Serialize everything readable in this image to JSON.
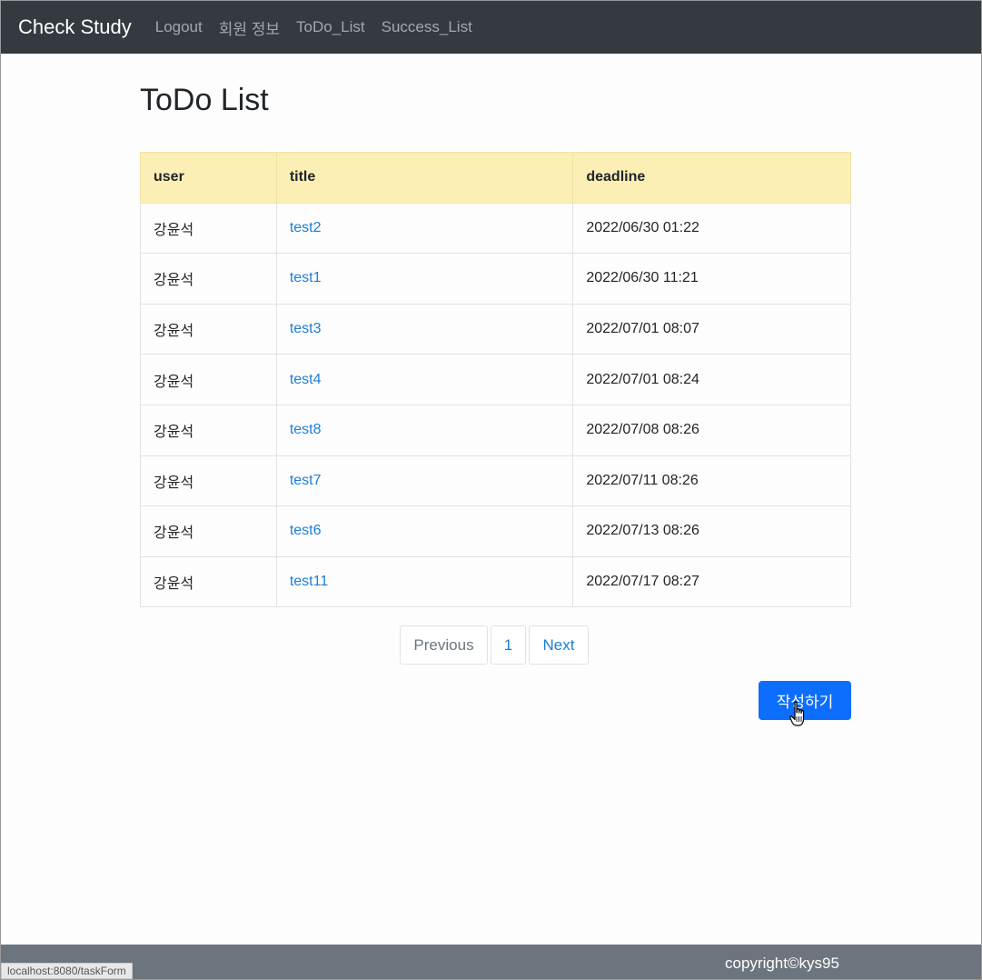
{
  "navbar": {
    "brand": "Check Study",
    "links": [
      "Logout",
      "회원 정보",
      "ToDo_List",
      "Success_List"
    ]
  },
  "page_title": "ToDo List",
  "table": {
    "headers": [
      "user",
      "title",
      "deadline"
    ],
    "rows": [
      {
        "user": "강윤석",
        "title": "test2",
        "deadline": "2022/06/30 01:22"
      },
      {
        "user": "강윤석",
        "title": "test1",
        "deadline": "2022/06/30 11:21"
      },
      {
        "user": "강윤석",
        "title": "test3",
        "deadline": "2022/07/01 08:07"
      },
      {
        "user": "강윤석",
        "title": "test4",
        "deadline": "2022/07/01 08:24"
      },
      {
        "user": "강윤석",
        "title": "test8",
        "deadline": "2022/07/08 08:26"
      },
      {
        "user": "강윤석",
        "title": "test7",
        "deadline": "2022/07/11 08:26"
      },
      {
        "user": "강윤석",
        "title": "test6",
        "deadline": "2022/07/13 08:26"
      },
      {
        "user": "강윤석",
        "title": "test11",
        "deadline": "2022/07/17 08:27"
      }
    ]
  },
  "pagination": {
    "previous": "Previous",
    "current": "1",
    "next": "Next"
  },
  "write_button": "작성하기",
  "footer": {
    "copyright": "copyright©kys95"
  },
  "status_url": "localhost:8080/taskForm",
  "colors": {
    "navbar_bg": "#343a40",
    "table_header_bg": "#fcefb6",
    "link": "#1e7ed6",
    "primary_button": "#0d6efd",
    "footer_bg": "#6c757d"
  },
  "icons": {
    "cursor": "hand-pointer-icon"
  }
}
